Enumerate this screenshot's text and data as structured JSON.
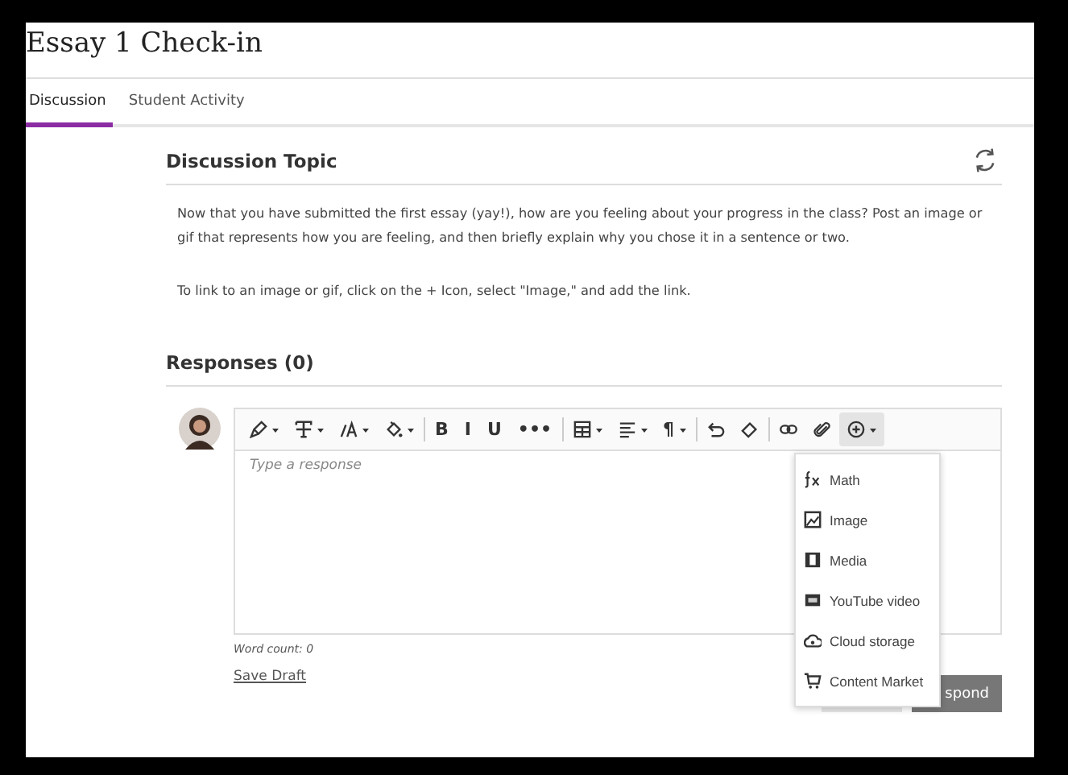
{
  "page": {
    "title": "Essay 1 Check-in"
  },
  "tabs": [
    {
      "label": "Discussion",
      "selected": true
    },
    {
      "label": "Student Activity",
      "selected": false
    }
  ],
  "topic": {
    "heading": "Discussion Topic",
    "paragraphs": [
      "Now that you have submitted the first essay (yay!), how are you feeling about your progress in the class? Post an image or gif that represents how you are feeling, and then briefly explain why you chose it in a sentence or two.",
      "To link to an image or gif, click on the + Icon, select \"Image,\" and add the link."
    ]
  },
  "responses": {
    "heading": "Responses (0)"
  },
  "editor": {
    "toolbar": [
      {
        "kind": "tool",
        "caret": true
      },
      {
        "kind": "tool",
        "caret": true
      },
      {
        "kind": "tool",
        "caret": true
      },
      {
        "kind": "tool",
        "caret": true
      },
      {
        "kind": "separator"
      },
      {
        "kind": "glyph",
        "glyph": "B",
        "caret": false
      },
      {
        "kind": "glyph",
        "glyph": "I",
        "caret": false
      },
      {
        "kind": "glyph",
        "glyph": "U",
        "caret": false
      },
      {
        "kind": "glyph",
        "glyph": "•••",
        "caret": false
      },
      {
        "kind": "separator"
      },
      {
        "kind": "tool",
        "caret": true
      },
      {
        "kind": "tool",
        "caret": true
      },
      {
        "kind": "glyph",
        "glyph": "¶",
        "caret": true
      },
      {
        "kind": "separator"
      },
      {
        "kind": "tool",
        "caret": false
      },
      {
        "kind": "tool",
        "caret": false
      },
      {
        "kind": "separator"
      },
      {
        "kind": "tool",
        "caret": false
      },
      {
        "kind": "tool",
        "caret": false
      },
      {
        "kind": "tool",
        "caret": true,
        "expanded": true
      }
    ],
    "placeholder": "Type a response",
    "word_count": "Word count: 0",
    "save_draft": "Save Draft",
    "submit_label": "spond"
  },
  "insert_menu": [
    {
      "label": "Math"
    },
    {
      "label": "Image"
    },
    {
      "label": "Media"
    },
    {
      "label": "YouTube video"
    },
    {
      "label": "Cloud storage"
    },
    {
      "label": "Content Market"
    }
  ]
}
